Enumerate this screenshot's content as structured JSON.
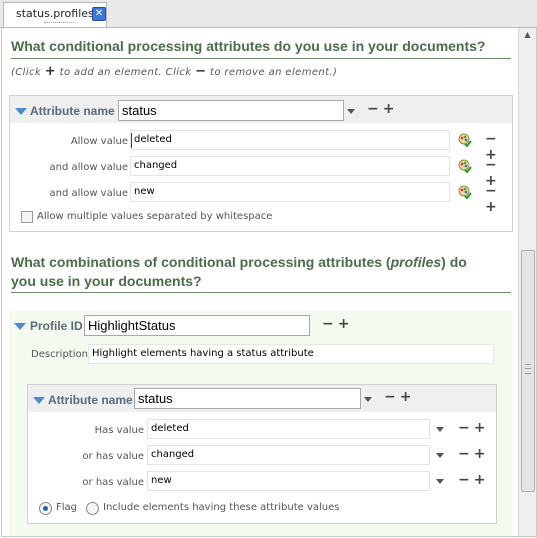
{
  "tab": {
    "label": "status.profiles"
  },
  "section1": {
    "question": "What conditional processing attributes do you use in your documents?",
    "hint_click": "(Click",
    "hint_add": "to add an element. Click",
    "hint_remove": "to remove an element.)",
    "attribute_label": "Attribute name",
    "attribute_value": "status",
    "rows": [
      {
        "label": "Allow value",
        "value": "deleted"
      },
      {
        "label": "and allow value",
        "value": "changed"
      },
      {
        "label": "and allow value",
        "value": "new"
      }
    ],
    "multi_label": "Allow multiple values separated by whitespace"
  },
  "section2": {
    "question_line1_a": "What combinations of conditional processing attributes (",
    "question_line1_em": "profiles",
    "question_line1_b": ") do",
    "question_line2": "you use in your documents?",
    "profile_label": "Profile ID",
    "profile_value": "HighlightStatus",
    "description_label": "Description",
    "description_value": "Highlight elements having a status attribute",
    "attribute_label": "Attribute name",
    "attribute_value": "status",
    "rows": [
      {
        "label": "Has value",
        "value": "deleted"
      },
      {
        "label": "or has value",
        "value": "changed"
      },
      {
        "label": "or has value",
        "value": "new"
      }
    ],
    "flag_label": "Flag",
    "include_label": "Include elements having these attribute values"
  },
  "controls": {
    "plus": "+",
    "minus": "−",
    "close": "✕"
  },
  "colors": {
    "accent": "#4b6d4b",
    "link": "#4a8ad6"
  }
}
